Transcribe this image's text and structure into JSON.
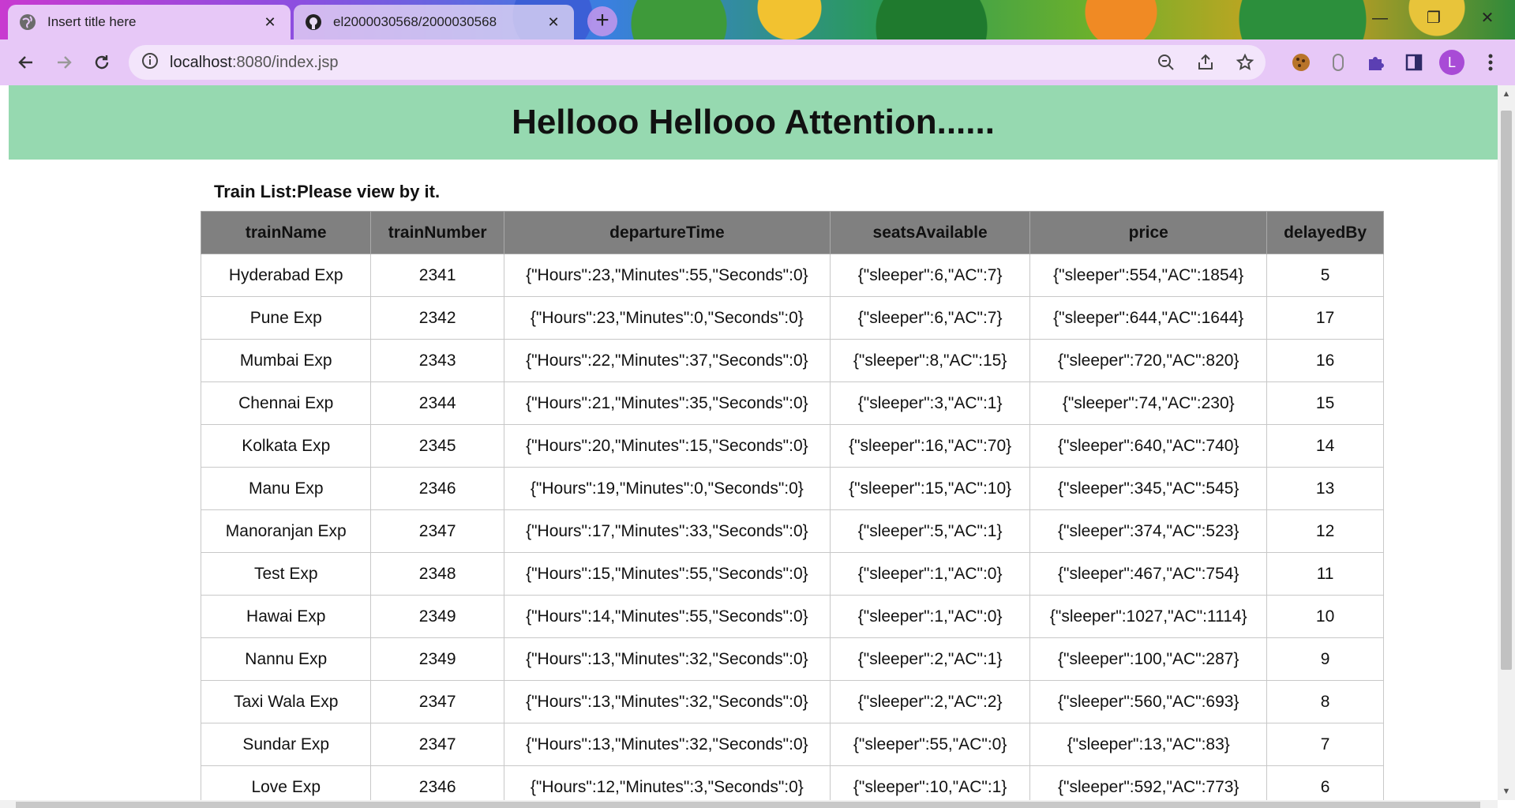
{
  "browser": {
    "tabs": [
      {
        "title": "Insert title here",
        "active": true,
        "icon": "globe-icon"
      },
      {
        "title": "el2000030568/2000030568",
        "active": false,
        "icon": "github-icon"
      }
    ],
    "new_tab_label": "+",
    "address": {
      "host": "localhost",
      "path": ":8080/index.jsp"
    },
    "profile_initial": "L",
    "theme_color": "#e7c8f7"
  },
  "page": {
    "banner_heading": "Hellooo Hellooo Attention......",
    "banner_color": "#96d9b0",
    "caption": "Train List:Please view by it.",
    "table": {
      "header_color": "#808080",
      "headers": [
        "trainName",
        "trainNumber",
        "departureTime",
        "seatsAvailable",
        "price",
        "delayedBy"
      ],
      "rows": [
        [
          "Hyderabad Exp",
          "2341",
          "{\"Hours\":23,\"Minutes\":55,\"Seconds\":0}",
          "{\"sleeper\":6,\"AC\":7}",
          "{\"sleeper\":554,\"AC\":1854}",
          "5"
        ],
        [
          "Pune Exp",
          "2342",
          "{\"Hours\":23,\"Minutes\":0,\"Seconds\":0}",
          "{\"sleeper\":6,\"AC\":7}",
          "{\"sleeper\":644,\"AC\":1644}",
          "17"
        ],
        [
          "Mumbai Exp",
          "2343",
          "{\"Hours\":22,\"Minutes\":37,\"Seconds\":0}",
          "{\"sleeper\":8,\"AC\":15}",
          "{\"sleeper\":720,\"AC\":820}",
          "16"
        ],
        [
          "Chennai Exp",
          "2344",
          "{\"Hours\":21,\"Minutes\":35,\"Seconds\":0}",
          "{\"sleeper\":3,\"AC\":1}",
          "{\"sleeper\":74,\"AC\":230}",
          "15"
        ],
        [
          "Kolkata Exp",
          "2345",
          "{\"Hours\":20,\"Minutes\":15,\"Seconds\":0}",
          "{\"sleeper\":16,\"AC\":70}",
          "{\"sleeper\":640,\"AC\":740}",
          "14"
        ],
        [
          "Manu Exp",
          "2346",
          "{\"Hours\":19,\"Minutes\":0,\"Seconds\":0}",
          "{\"sleeper\":15,\"AC\":10}",
          "{\"sleeper\":345,\"AC\":545}",
          "13"
        ],
        [
          "Manoranjan Exp",
          "2347",
          "{\"Hours\":17,\"Minutes\":33,\"Seconds\":0}",
          "{\"sleeper\":5,\"AC\":1}",
          "{\"sleeper\":374,\"AC\":523}",
          "12"
        ],
        [
          "Test Exp",
          "2348",
          "{\"Hours\":15,\"Minutes\":55,\"Seconds\":0}",
          "{\"sleeper\":1,\"AC\":0}",
          "{\"sleeper\":467,\"AC\":754}",
          "11"
        ],
        [
          "Hawai Exp",
          "2349",
          "{\"Hours\":14,\"Minutes\":55,\"Seconds\":0}",
          "{\"sleeper\":1,\"AC\":0}",
          "{\"sleeper\":1027,\"AC\":1114}",
          "10"
        ],
        [
          "Nannu Exp",
          "2349",
          "{\"Hours\":13,\"Minutes\":32,\"Seconds\":0}",
          "{\"sleeper\":2,\"AC\":1}",
          "{\"sleeper\":100,\"AC\":287}",
          "9"
        ],
        [
          "Taxi Wala Exp",
          "2347",
          "{\"Hours\":13,\"Minutes\":32,\"Seconds\":0}",
          "{\"sleeper\":2,\"AC\":2}",
          "{\"sleeper\":560,\"AC\":693}",
          "8"
        ],
        [
          "Sundar Exp",
          "2347",
          "{\"Hours\":13,\"Minutes\":32,\"Seconds\":0}",
          "{\"sleeper\":55,\"AC\":0}",
          "{\"sleeper\":13,\"AC\":83}",
          "7"
        ],
        [
          "Love Exp",
          "2346",
          "{\"Hours\":12,\"Minutes\":3,\"Seconds\":0}",
          "{\"sleeper\":10,\"AC\":1}",
          "{\"sleeper\":592,\"AC\":773}",
          "6"
        ]
      ]
    }
  }
}
